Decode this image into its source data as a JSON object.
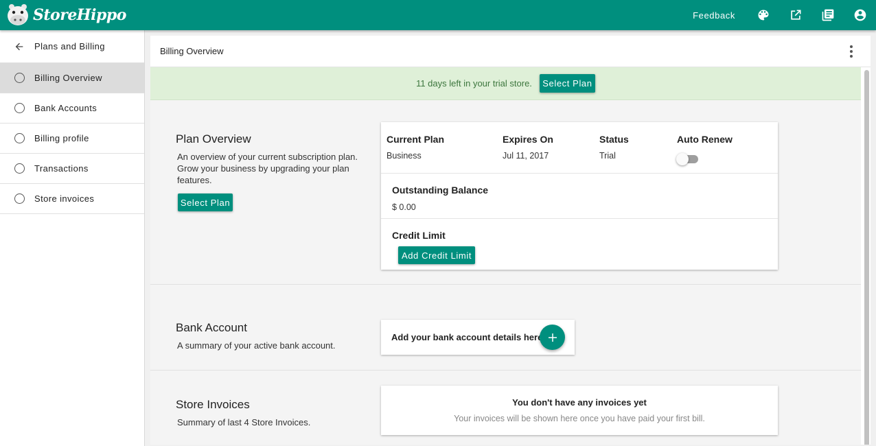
{
  "app": {
    "brand": "StoreHippo",
    "accent_color": "#008f7e",
    "feedback_label": "Feedback",
    "icons": [
      "palette-icon",
      "external-link-icon",
      "library-books-icon",
      "account-circle-icon"
    ]
  },
  "sidebar": {
    "back_label": "Plans and Billing",
    "items": [
      {
        "label": "Billing Overview",
        "active": true
      },
      {
        "label": "Bank Accounts",
        "active": false
      },
      {
        "label": "Billing profile",
        "active": false
      },
      {
        "label": "Transactions",
        "active": false
      },
      {
        "label": "Store invoices",
        "active": false
      }
    ]
  },
  "main": {
    "title": "Billing Overview",
    "trial_banner": {
      "message": "11 days left in your trial store.",
      "button_label": "Select Plan",
      "bg_color": "#dff0d8"
    },
    "plan_overview": {
      "title": "Plan Overview",
      "desc_lines": [
        "An overview of your current subscription plan.",
        "Grow your business by upgrading your plan",
        "features."
      ],
      "button_label": "Select Plan",
      "card": {
        "current_plan_label": "Current Plan",
        "current_plan_value": "Business",
        "expires_label": "Expires On",
        "expires_value": "Jul 11, 2017",
        "status_label": "Status",
        "status_value": "Trial",
        "auto_renew_label": "Auto Renew",
        "auto_renew_on": false,
        "outstanding_label": "Outstanding Balance",
        "outstanding_value": "$ 0.00",
        "credit_label": "Credit Limit",
        "credit_button_label": "Add Credit Limit"
      }
    },
    "bank_account": {
      "title": "Bank Account",
      "desc": "A summary of your active bank account.",
      "card_text": "Add your bank account details here"
    },
    "store_invoices": {
      "title": "Store Invoices",
      "desc": "Summary of last 4 Store Invoices.",
      "empty_title": "You don't have any invoices yet",
      "empty_desc": "Your invoices will be shown here once you have paid your first bill."
    }
  }
}
